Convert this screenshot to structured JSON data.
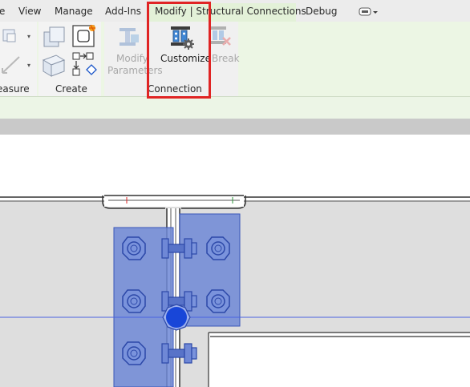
{
  "tabs": {
    "insert": "e",
    "view": "View",
    "manage": "Manage",
    "addins": "Add-Ins",
    "active": "Modify | Structural Connections",
    "debug": "Debug"
  },
  "ribbon": {
    "panel_measure": {
      "label": "easure"
    },
    "panel_create": {
      "label": "Create"
    },
    "panel_connection": {
      "label": "Connection",
      "buttons": {
        "modify_parameters": {
          "line1": "Modify",
          "line2": "Parameters"
        },
        "customize": {
          "label": "Customize"
        },
        "break": {
          "label": "Break"
        }
      }
    }
  },
  "colors": {
    "highlight": "#e02424",
    "connection_fill": "#6f88d6",
    "connection_stroke": "#3a56b8",
    "joint": "#1846d8",
    "beam": "#dedede",
    "ribbon": "#ecf6e4"
  }
}
